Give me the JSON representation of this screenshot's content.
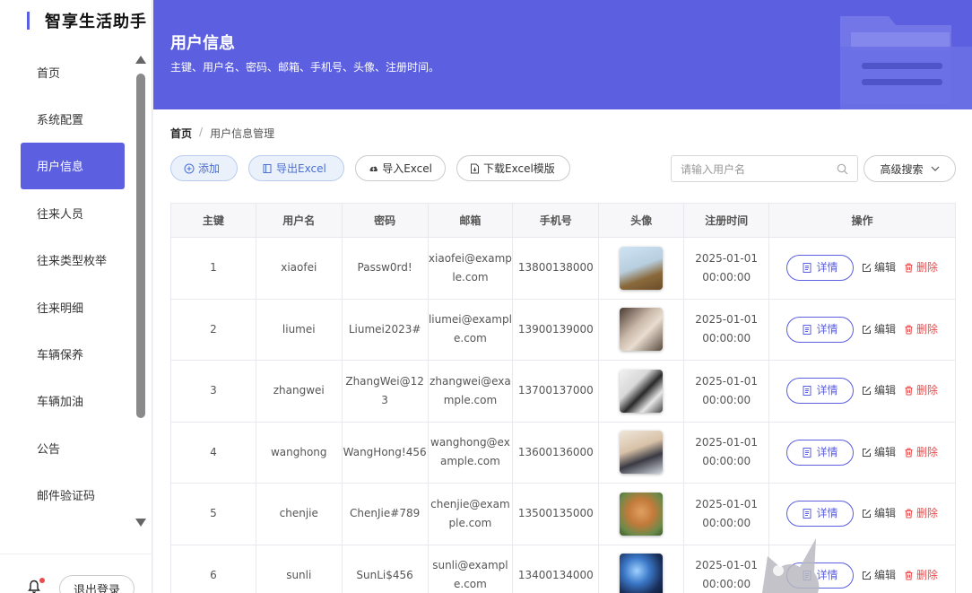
{
  "sidebar": {
    "brand": "智享生活助手",
    "items": [
      {
        "label": "首页",
        "active": false
      },
      {
        "label": "系统配置",
        "active": false
      },
      {
        "label": "用户信息",
        "active": true
      },
      {
        "label": "往来人员",
        "active": false
      },
      {
        "label": "往来类型枚举",
        "active": false
      },
      {
        "label": "往来明细",
        "active": false
      },
      {
        "label": "车辆保养",
        "active": false
      },
      {
        "label": "车辆加油",
        "active": false
      },
      {
        "label": "公告",
        "active": false
      },
      {
        "label": "邮件验证码",
        "active": false
      }
    ],
    "logout": "退出登录"
  },
  "header": {
    "title": "用户信息",
    "subtitle": "主键、用户名、密码、邮箱、手机号、头像、注册时间。"
  },
  "breadcrumb": {
    "home": "首页",
    "sep": "/",
    "current": "用户信息管理"
  },
  "toolbar": {
    "add": "添加",
    "export": "导出Excel",
    "import": "导入Excel",
    "template": "下载Excel模版",
    "search_placeholder": "请输入用户名",
    "advanced": "高级搜索"
  },
  "table": {
    "headers": [
      "主键",
      "用户名",
      "密码",
      "邮箱",
      "手机号",
      "头像",
      "注册时间",
      "操作"
    ],
    "rows": [
      {
        "id": "1",
        "username": "xiaofei",
        "password": "Passw0rd!",
        "email": "xiaofei@example.com",
        "phone": "13800138000",
        "date": "2025-01-01",
        "time": "00:00:00"
      },
      {
        "id": "2",
        "username": "liumei",
        "password": "Liumei2023#",
        "email": "liumei@example.com",
        "phone": "13900139000",
        "date": "2025-01-01",
        "time": "00:00:00"
      },
      {
        "id": "3",
        "username": "zhangwei",
        "password": "ZhangWei@123",
        "email": "zhangwei@example.com",
        "phone": "13700137000",
        "date": "2025-01-01",
        "time": "00:00:00"
      },
      {
        "id": "4",
        "username": "wanghong",
        "password": "WangHong!456",
        "email": "wanghong@example.com",
        "phone": "13600136000",
        "date": "2025-01-01",
        "time": "00:00:00"
      },
      {
        "id": "5",
        "username": "chenjie",
        "password": "ChenJie#789",
        "email": "chenjie@example.com",
        "phone": "13500135000",
        "date": "2025-01-01",
        "time": "00:00:00"
      },
      {
        "id": "6",
        "username": "sunli",
        "password": "SunLi$456",
        "email": "sunli@example.com",
        "phone": "13400134000",
        "date": "2025-01-01",
        "time": "00:00:00"
      }
    ],
    "actions": {
      "detail": "详情",
      "edit": "编辑",
      "delete": "删除"
    }
  },
  "colors": {
    "accent": "#5b5fe0",
    "danger": "#e84c4c"
  }
}
